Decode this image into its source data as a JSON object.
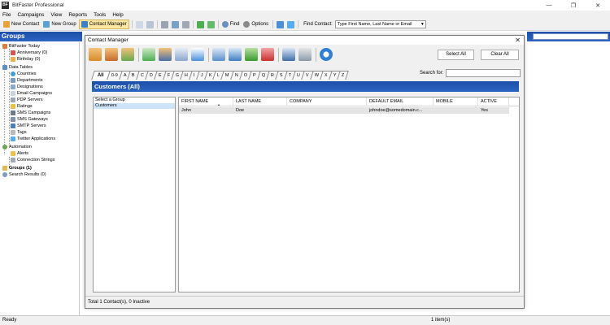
{
  "window": {
    "title": "BitFaster Professional",
    "app_icon_text": "BF"
  },
  "menu": [
    "File",
    "Campaigns",
    "View",
    "Reports",
    "Tools",
    "Help"
  ],
  "toolbar": {
    "new_contact": "New Contact",
    "new_group": "New Group",
    "contact_manager": "Contact Manager",
    "find": "Find",
    "options": "Options",
    "find_contact_label": "Find Contact:",
    "find_contact_value": "Type First Name, Last Name or Email"
  },
  "groups_panel": {
    "title": "Groups",
    "items": [
      "BitFaster Today",
      "Anniversary (0)",
      "Birthday (0)",
      "Data Tables",
      "Countries",
      "Departments",
      "Designations",
      "Email Campaigns",
      "PDP Servers",
      "Ratings",
      "SMS Campaigns",
      "SMS Gateways",
      "SMTP Servers",
      "Tags",
      "Twitter Applications",
      "Automation",
      "Alerts",
      "Connection Strings",
      "Groups (1)",
      "Search Results (0)"
    ]
  },
  "dialog": {
    "title": "Contact Manager",
    "select_all": "Select All",
    "clear_all": "Clear All",
    "alpha_tabs": [
      "All",
      "0-9",
      "A",
      "B",
      "C",
      "D",
      "E",
      "F",
      "G",
      "H",
      "I",
      "J",
      "K",
      "L",
      "M",
      "N",
      "O",
      "P",
      "Q",
      "R",
      "S",
      "T",
      "U",
      "V",
      "W",
      "X",
      "Y",
      "Z"
    ],
    "search_for_label": "Search for:",
    "section_title": "Customers (All)",
    "group_list": [
      "Select a Group",
      "Customers"
    ],
    "columns": [
      "FIRST NAME",
      "LAST NAME",
      "COMPANY",
      "DEFAULT EMAIL",
      "MOBILE",
      "ACTIVE"
    ],
    "rows": [
      [
        "John",
        "Doe",
        "",
        "johndoe@somedomain.c...",
        "",
        "Yes"
      ]
    ],
    "status": "Total 1 Contact(s), 0 Inactive"
  },
  "statusbar": {
    "left": "Ready",
    "middle": "1 item(s)"
  },
  "colors": {
    "header_blue": "#1b4fa8",
    "selection": "#cde3f8",
    "active_button": "#fbe7a4"
  }
}
